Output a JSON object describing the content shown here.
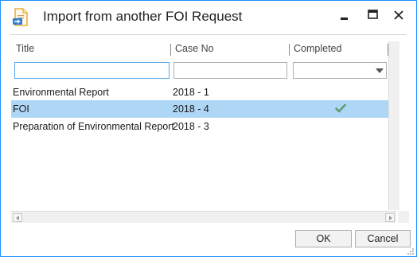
{
  "window": {
    "title": "Import from another FOI Request",
    "app_icon": "document-import-icon",
    "minimize_icon": "minimize-icon",
    "maximize_icon": "maximize-icon",
    "close_icon": "close-icon"
  },
  "grid": {
    "columns": [
      "Title",
      "Case No",
      "Completed"
    ],
    "filters": {
      "title_value": "",
      "case_value": "",
      "completed_value": ""
    },
    "rows": [
      {
        "title": "Environmental Report",
        "case_no": "2018 - 1",
        "completed": false,
        "selected": false
      },
      {
        "title": "FOI",
        "case_no": "2018 - 4",
        "completed": true,
        "selected": true
      },
      {
        "title": "Preparation of Environmental Report",
        "case_no": "2018 - 3",
        "completed": false,
        "selected": false
      }
    ],
    "check_icon": "check-icon",
    "selection_color": "#aed6f5",
    "check_color": "#5e9e6e"
  },
  "buttons": {
    "ok_label": "OK",
    "cancel_label": "Cancel"
  },
  "colors": {
    "window_border": "#1e90ff"
  }
}
